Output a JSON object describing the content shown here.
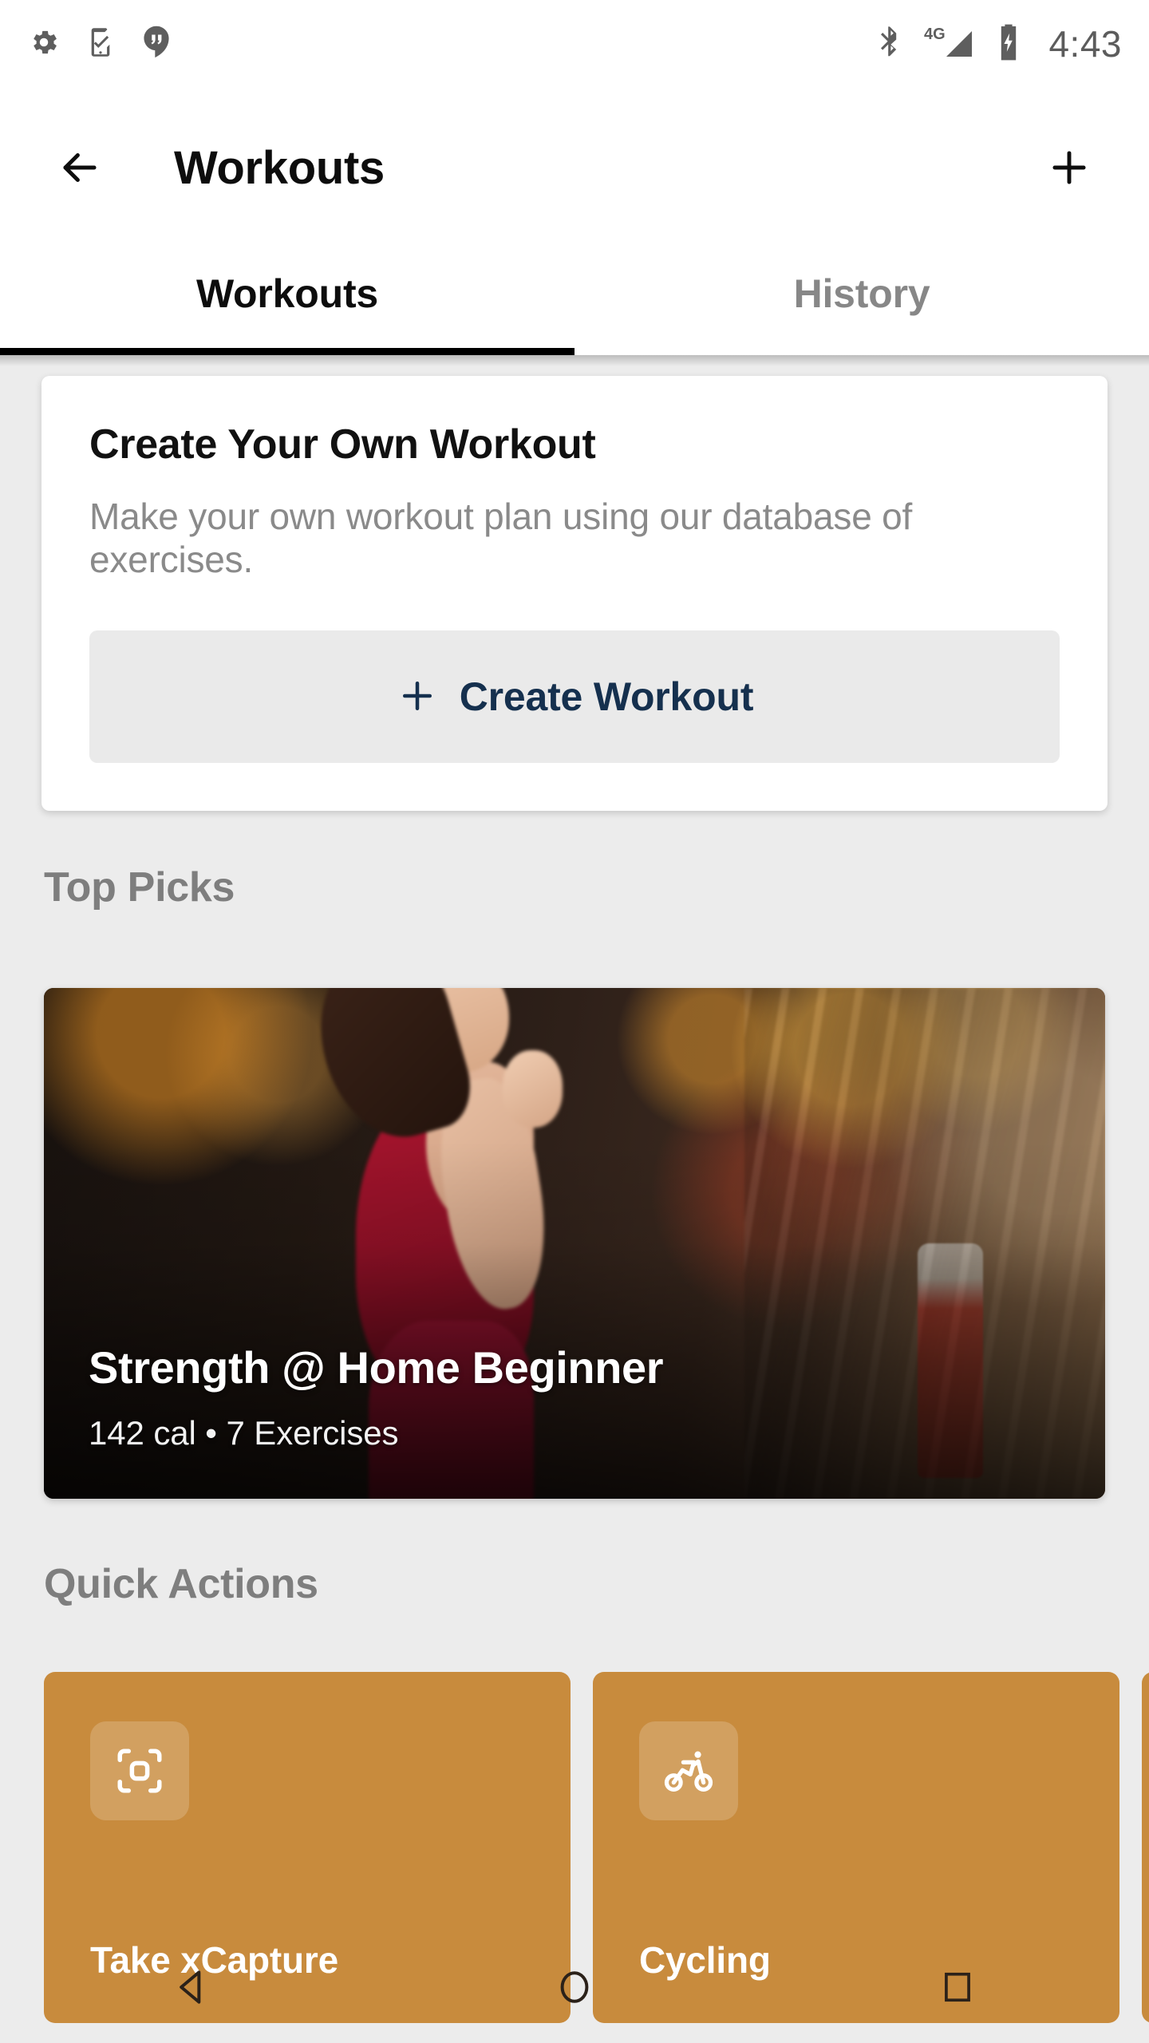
{
  "status_bar": {
    "notification_icons": [
      "gear-icon",
      "phone-setup-check-icon",
      "hangouts-quote-icon"
    ],
    "system_icons": [
      "bluetooth-icon",
      "signal-4g-icon",
      "battery-charging-icon"
    ],
    "network_label": "4G",
    "time": "4:43"
  },
  "app_bar": {
    "back_icon": "back-arrow-icon",
    "title": "Workouts",
    "add_icon": "plus-icon"
  },
  "tabs": {
    "items": [
      {
        "label": "Workouts",
        "active": true
      },
      {
        "label": "History",
        "active": false
      }
    ],
    "indicator_color": "#000000"
  },
  "create_card": {
    "title": "Create Your Own Workout",
    "description": "Make your own workout plan using our database of exercises.",
    "button_label": "Create Workout",
    "button_icon": "plus-icon",
    "button_bg": "#EAEAEA",
    "button_text_color": "#15304E"
  },
  "top_picks": {
    "heading": "Top Picks",
    "featured": {
      "title": "Strength @ Home Beginner",
      "meta": "142 cal • 7 Exercises",
      "calories": "142 cal",
      "exercise_count": "7 Exercises",
      "image_alt": "woman-running-treadmill-gym"
    }
  },
  "quick_actions": {
    "heading": "Quick Actions",
    "card_color": "#C88B3D",
    "items": [
      {
        "label": "Take xCapture",
        "icon": "scan-frame-icon"
      },
      {
        "label": "Cycling",
        "icon": "cyclist-icon"
      },
      {
        "label": "",
        "icon": ""
      }
    ]
  },
  "nav_bar": {
    "back": "back-triangle-icon",
    "home": "home-circle-icon",
    "recents": "recents-square-icon"
  },
  "theme": {
    "page_bg": "#ECECEC",
    "surface": "#FFFFFF",
    "muted_text": "#8A8A8A",
    "heading_text": "#7E7E7E",
    "accent_orange": "#C88B3D",
    "navy": "#15304E"
  }
}
